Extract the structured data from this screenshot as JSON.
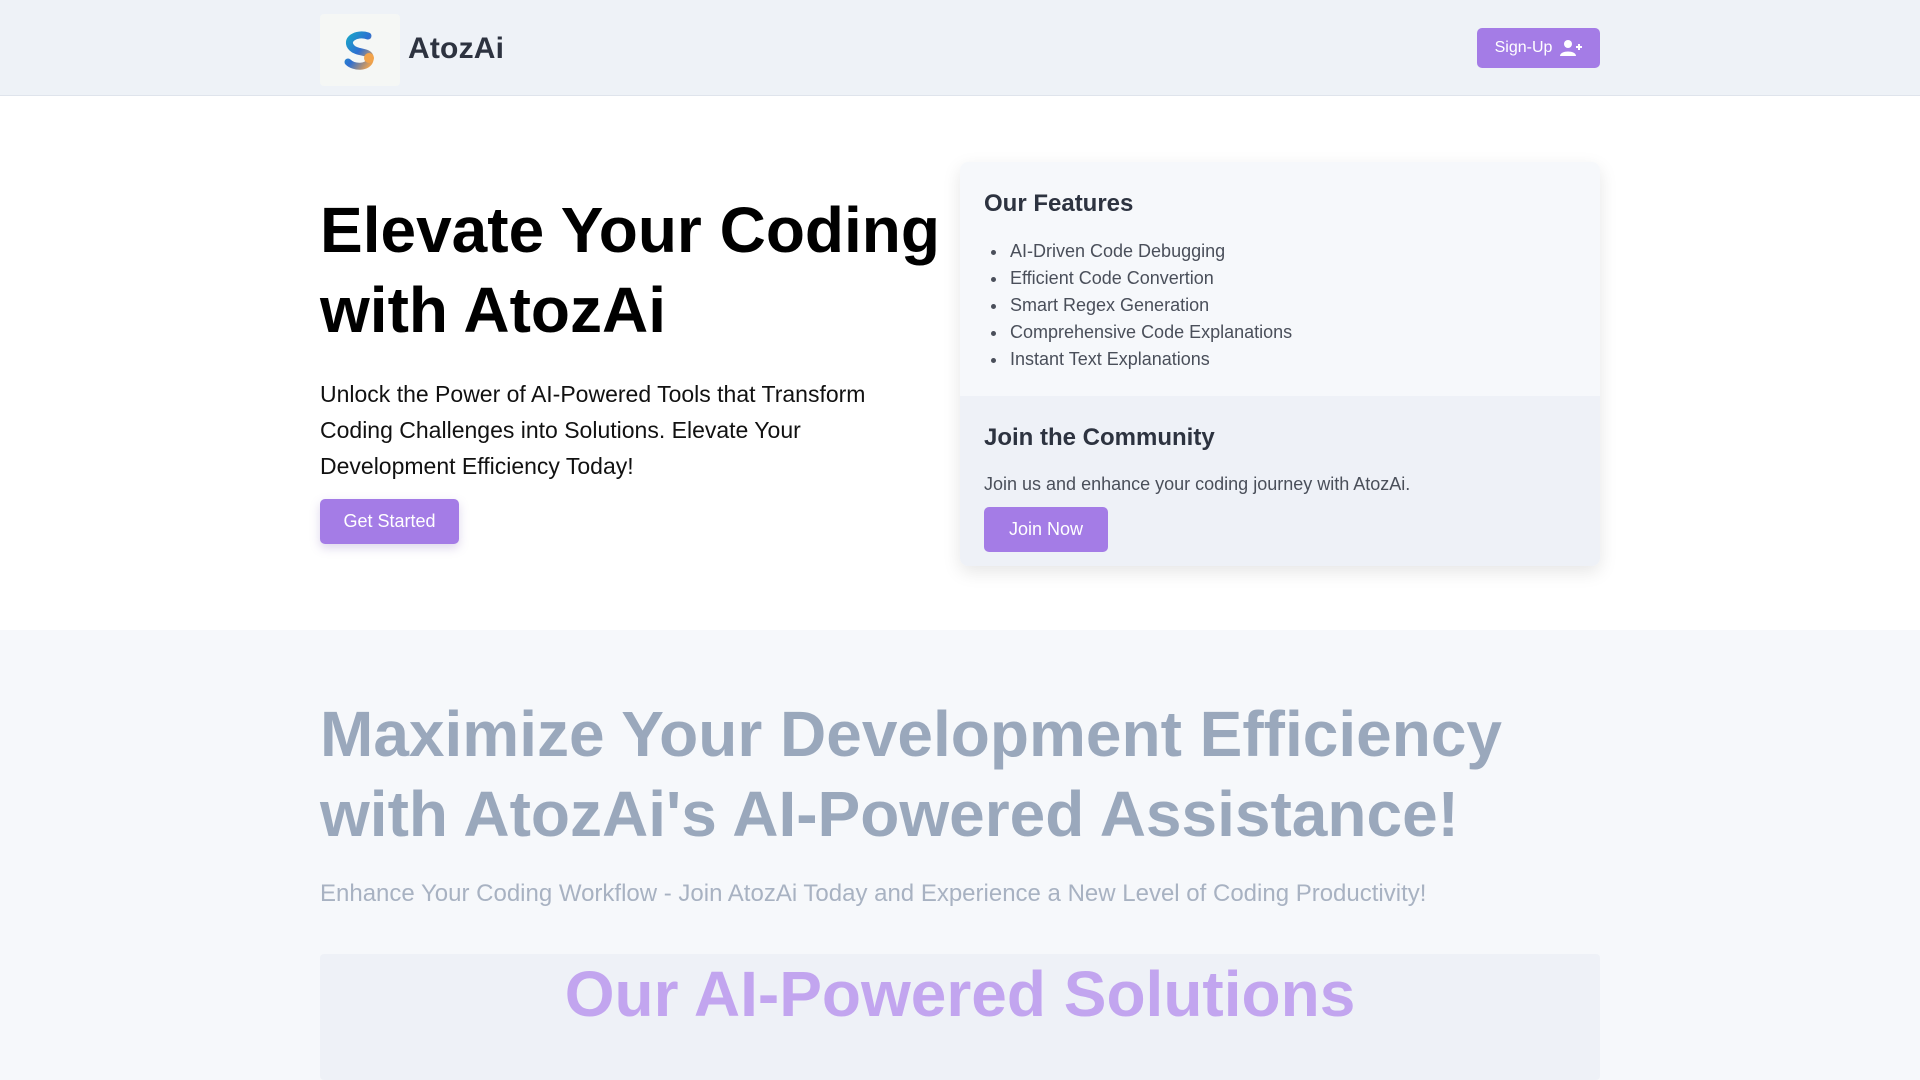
{
  "header": {
    "brand": "AtozAi",
    "signup_label": "Sign-Up",
    "signup_icon": "user-plus-icon"
  },
  "hero": {
    "title": "Elevate Your Coding with AtozAi",
    "subtitle": "Unlock the Power of AI-Powered Tools that Transform Coding Challenges into Solutions. Elevate Your Development Efficiency Today!",
    "cta_label": "Get Started"
  },
  "features": {
    "title": "Our Features",
    "items": [
      "AI-Driven Code Debugging",
      "Efficient Code Convertion",
      "Smart Regex Generation",
      "Comprehensive Code Explanations",
      "Instant Text Explanations"
    ]
  },
  "community": {
    "title": "Join the Community",
    "text": "Join us and enhance your coding journey with AtozAi.",
    "button_label": "Join Now"
  },
  "section2": {
    "title": "Maximize Your Development Efficiency with AtozAi's AI-Powered Assistance!",
    "subtitle": "Enhance Your Coding Workflow - Join AtozAi Today and Experience a New Level of Coding Productivity!",
    "solutions_title": "Our AI-Powered Solutions"
  },
  "colors": {
    "accent": "#a47ce6",
    "header_bg": "#eef2f7",
    "muted_heading": "#9aa8bc",
    "solutions_heading": "#c2a5ef"
  }
}
